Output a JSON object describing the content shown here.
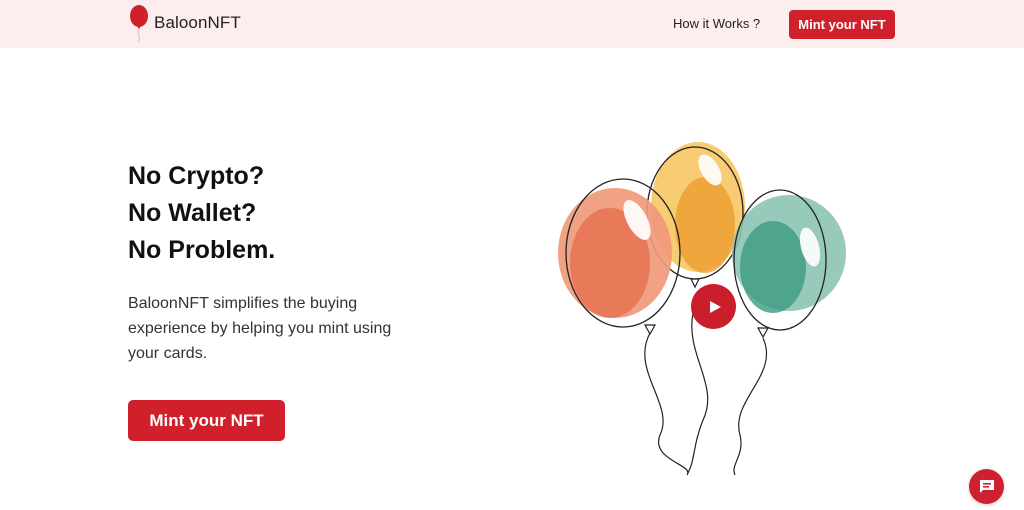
{
  "brand": {
    "name": "BaloonNFT",
    "logo_icon": "balloon-icon",
    "logo_color": "#d0202b"
  },
  "nav": {
    "how_it_works": "How it Works ?",
    "mint_button": "Mint your NFT"
  },
  "hero": {
    "title_lines": [
      "No Crypto?",
      "No Wallet?",
      "No Problem."
    ],
    "description": "BaloonNFT simplifies the buying experience by helping you mint using your cards.",
    "cta_label": "Mint your NFT"
  },
  "illustration": {
    "balloons": [
      {
        "name": "orange-balloon",
        "color": "#ee8866"
      },
      {
        "name": "yellow-balloon",
        "color": "#f3b83e"
      },
      {
        "name": "teal-balloon",
        "color": "#6fb4a2"
      }
    ],
    "play_icon": "play-icon"
  },
  "chat": {
    "icon": "chat-icon"
  },
  "colors": {
    "accent": "#d0202b",
    "nav_background": "#fdeeee"
  }
}
